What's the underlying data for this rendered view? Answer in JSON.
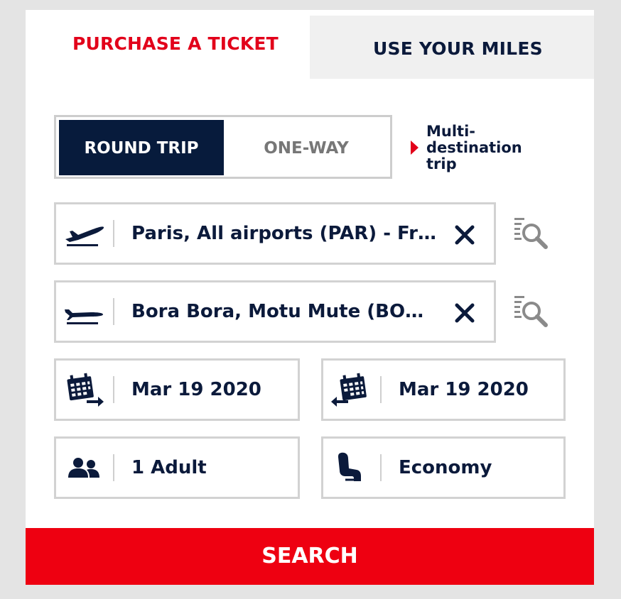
{
  "tabs": {
    "purchase_label": "PURCHASE A TICKET",
    "miles_label": "USE YOUR MILES"
  },
  "trip_type": {
    "round_trip_label": "ROUND TRIP",
    "one_way_label": "ONE-WAY",
    "selected": "ROUND TRIP",
    "multi_destination_label": "Multi-destination trip"
  },
  "origin": {
    "value": "Paris, All airports (PAR) - Fr…",
    "icon": "departure-plane-icon"
  },
  "destination": {
    "value": "Bora Bora, Motu Mute (BO…",
    "icon": "arrival-plane-icon"
  },
  "dates": {
    "outbound": "Mar 19 2020",
    "return": "Mar 19 2020"
  },
  "passengers": {
    "value": "1 Adult",
    "icon": "passengers-icon"
  },
  "cabin": {
    "value": "Economy",
    "icon": "seat-icon"
  },
  "search": {
    "label": "SEARCH"
  },
  "colors": {
    "accent_red": "#ee0011",
    "navy": "#071b3c",
    "tab_inactive_bg": "#f0f0f0",
    "border": "#d2d2d2"
  }
}
